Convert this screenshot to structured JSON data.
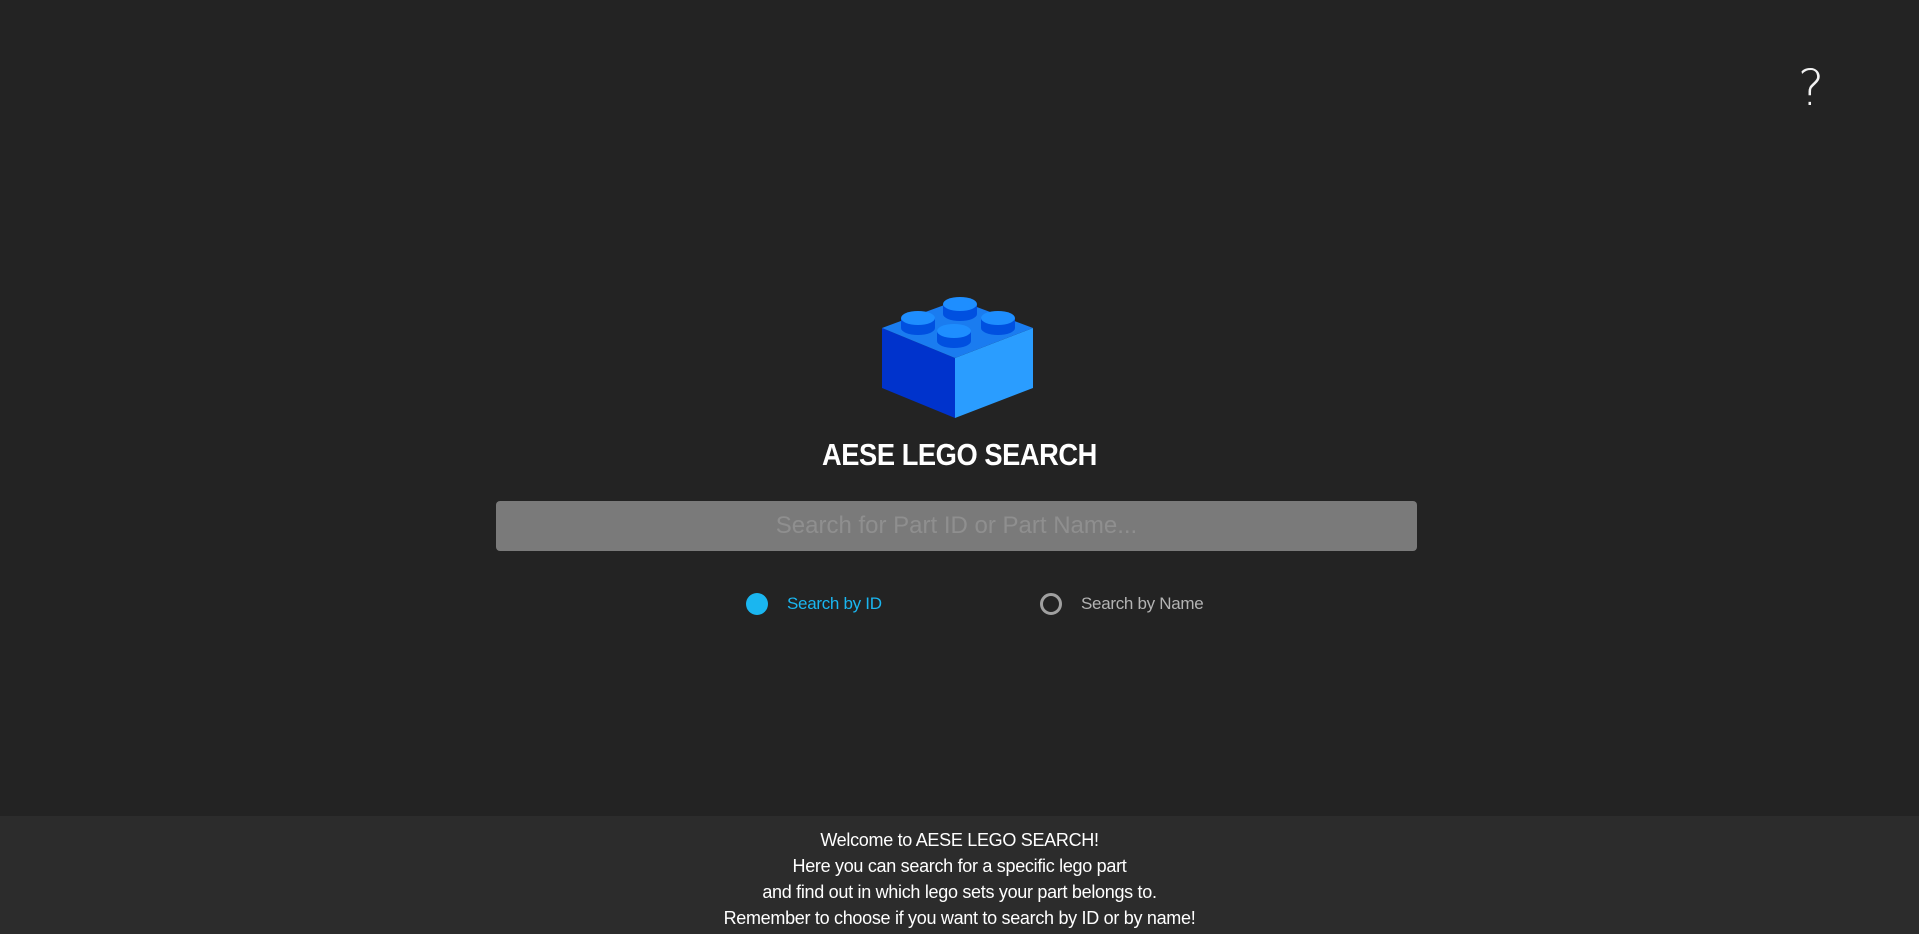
{
  "help": {
    "label": "?",
    "icon": "question-mark-icon"
  },
  "logo": {
    "icon": "lego-brick-icon",
    "colors": {
      "top": "#1e8eff",
      "left": "#0030cc",
      "right": "#2aa0ff",
      "studs_side": "#0050e0"
    }
  },
  "app": {
    "title": "AESE LEGO SEARCH"
  },
  "search": {
    "placeholder": "Search for Part ID or Part Name...",
    "value": ""
  },
  "search_mode": {
    "options": [
      {
        "label": "Search by ID",
        "selected": true
      },
      {
        "label": "Search by Name",
        "selected": false
      }
    ],
    "accent_color": "#1ab6f0"
  },
  "footer": {
    "lines": [
      "Welcome to AESE LEGO SEARCH!",
      "Here you can search for a specific lego part",
      "and find out in which lego sets your part belongs to.",
      "Remember to choose if you want to search by ID or by name!"
    ]
  }
}
